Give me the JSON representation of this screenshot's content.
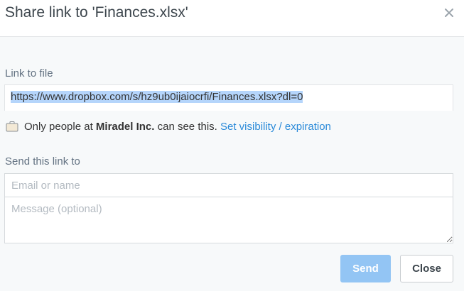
{
  "dialog": {
    "title": "Share link to 'Finances.xlsx'",
    "close_icon": "close-icon"
  },
  "link_section": {
    "label": "Link to file",
    "url": "https://www.dropbox.com/s/hz9ub0ijaiocrfi/Finances.xlsx?dl=0"
  },
  "visibility": {
    "icon": "briefcase-icon",
    "prefix": "Only people at",
    "org": "Miradel Inc.",
    "suffix": "can see this.",
    "link": "Set visibility / expiration"
  },
  "send_section": {
    "label": "Send this link to",
    "email_placeholder": "Email or name",
    "email_value": "",
    "message_placeholder": "Message (optional)",
    "message_value": ""
  },
  "buttons": {
    "send_label": "Send",
    "close_label": "Close"
  },
  "colors": {
    "link": "#2a8ad9",
    "send_disabled": "#93c5f4",
    "selection": "#b5d5fb"
  }
}
